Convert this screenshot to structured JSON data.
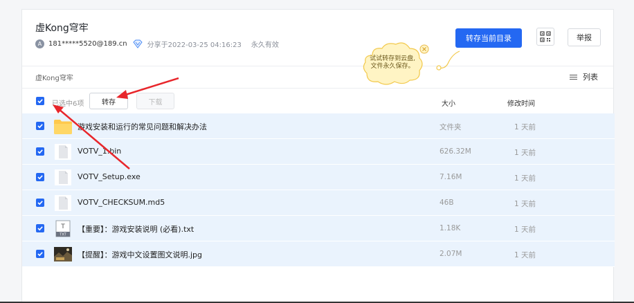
{
  "share": {
    "title": "虚Kong穹牢",
    "avatar_letter": "A",
    "user": "181*****5520@189.cn",
    "shared_at": "分享于2022-03-25 04:16:23",
    "validity": "永久有效"
  },
  "toolbar": {
    "save_current_dir": "转存当前目录",
    "qr_icon": "qr-code-icon",
    "report": "举报"
  },
  "tooltip": {
    "line1": "试试转存到云盘,",
    "line2": "文件永久保存。"
  },
  "breadcrumb": "虚Kong穹牢",
  "view_toggle": "列表",
  "table": {
    "selected_text": "已选中6项",
    "save_button": "转存",
    "download_button": "下载",
    "col_size": "大小",
    "col_modified": "修改时间",
    "rows": [
      {
        "name": "游戏安装和运行的常见问题和解决办法",
        "size": "文件夹",
        "time": "1 天前",
        "icon": "folder-icon"
      },
      {
        "name": "VOTV_1.bin",
        "size": "626.32M",
        "time": "1 天前",
        "icon": "file-icon"
      },
      {
        "name": "VOTV_Setup.exe",
        "size": "7.16M",
        "time": "1 天前",
        "icon": "file-icon"
      },
      {
        "name": "VOTV_CHECKSUM.md5",
        "size": "46B",
        "time": "1 天前",
        "icon": "file-icon"
      },
      {
        "name": "【重要】：游戏安装说明 (必看).txt",
        "size": "1.18K",
        "time": "1 天前",
        "icon": "txt-icon"
      },
      {
        "name": "【提醒】：游戏中文设置图文说明.jpg",
        "size": "2.07M",
        "time": "1 天前",
        "icon": "image-thumbnail"
      }
    ]
  },
  "colors": {
    "accent": "#2468f2",
    "row_selected_bg": "#eaf3fd",
    "annotation_arrow": "#e8262b",
    "tooltip_bg": "#fff4c4"
  }
}
